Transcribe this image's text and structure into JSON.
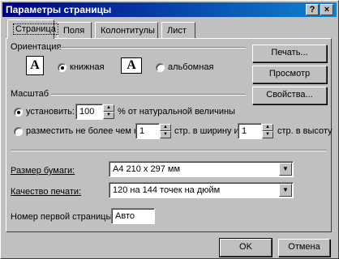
{
  "window": {
    "title": "Параметры страницы",
    "help_glyph": "?",
    "close_glyph": "×"
  },
  "tabs": [
    {
      "label": "Страница",
      "active": true
    },
    {
      "label": "Поля",
      "active": false
    },
    {
      "label": "Колонтитулы",
      "active": false
    },
    {
      "label": "Лист",
      "active": false
    }
  ],
  "orientation": {
    "heading": "Ориентация",
    "icon_glyph": "A",
    "portrait_label": "книжная",
    "landscape_label": "альбомная",
    "selected": "portrait"
  },
  "scale": {
    "heading": "Масштаб",
    "adjust_label": "установить:",
    "adjust_value": "100",
    "adjust_suffix": "% от натуральной величины",
    "fit_label": "разместить не более чем на:",
    "fit_wide_value": "1",
    "fit_wide_suffix": "стр. в ширину и",
    "fit_tall_value": "1",
    "fit_tall_suffix": "стр. в высоту",
    "selected": "adjust"
  },
  "paper_size": {
    "label": "Размер бумаги:",
    "value": "A4 210 x 297 мм"
  },
  "print_quality": {
    "label": "Качество печати:",
    "value": "120 на 144 точек на дюйм"
  },
  "first_page": {
    "label": "Номер первой страницы:",
    "value": "Авто"
  },
  "side_buttons": {
    "print": "Печать...",
    "preview": "Просмотр",
    "properties": "Свойства..."
  },
  "footer_buttons": {
    "ok": "OK",
    "cancel": "Отмена"
  },
  "glyphs": {
    "spin_up": "▲",
    "spin_down": "▼",
    "dropdown": "▼"
  }
}
